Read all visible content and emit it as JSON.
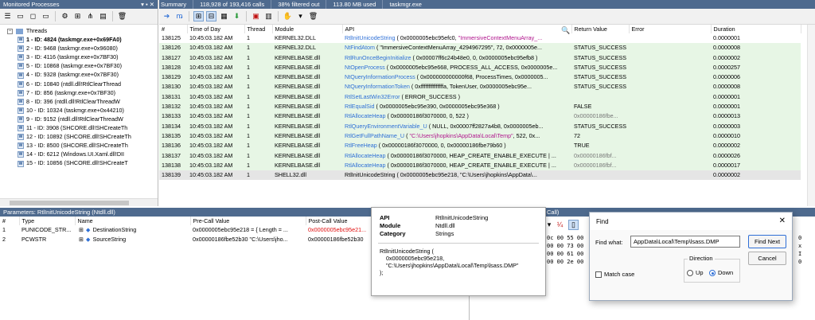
{
  "left_panel": {
    "title": "Monitored Processes",
    "title_controls": "▾ ▪ ✕",
    "root": "Threads",
    "threads": [
      {
        "label": "1 - ID: 4824 (taskmgr.exe+0x69FA0)",
        "selected": true
      },
      {
        "label": "2 - ID: 9468 (taskmgr.exe+0x96080)"
      },
      {
        "label": "3 - ID: 4116 (taskmgr.exe+0x7BF30)"
      },
      {
        "label": "5 - ID: 10868 (taskmgr.exe+0x7BF30)"
      },
      {
        "label": "4 - ID: 9328 (taskmgr.exe+0x7BF30)"
      },
      {
        "label": "6 - ID: 10840 (ntdll.dll!RtlClearThread"
      },
      {
        "label": "7 - ID: 856 (taskmgr.exe+0x7BF30)"
      },
      {
        "label": "8 - ID: 396 (ntdll.dll!RtlClearThreadW"
      },
      {
        "label": "10 - ID: 10324 (taskmgr.exe+0x44210)"
      },
      {
        "label": "9 - ID: 9152 (ntdll.dll!RtlClearThreadW"
      },
      {
        "label": "11 - ID: 3908 (SHCORE.dll!SHCreateTh"
      },
      {
        "label": "12 - ID: 10892 (SHCORE.dll!SHCreateTh"
      },
      {
        "label": "13 - ID: 8500 (SHCORE.dll!SHCreateTh"
      },
      {
        "label": "14 - ID: 6212 (Windows.UI.Xaml.dll!DII"
      },
      {
        "label": "15 - ID: 10856 (SHCORE.dll!SHCreateT"
      }
    ]
  },
  "summary_bar": {
    "label": "Summary",
    "calls": "118,928 of 193,416 calls",
    "filtered": "38% filtered out",
    "memory": "113.80 MB used",
    "process": "taskmgr.exe"
  },
  "grid": {
    "columns": [
      "#",
      "Time of Day",
      "Thread",
      "Module",
      "API",
      "Return Value",
      "Error",
      "Duration"
    ],
    "rows": [
      {
        "num": "138125",
        "time": "10:45:03.182 AM",
        "thread": "1",
        "module": "KERNEL32.DLL",
        "fn": "RtlInitUnicodeString",
        "args": " ( 0x0000005ebc95efc0, ",
        "str": "\"ImmersiveContextMenuArray_...",
        "ret": "",
        "ret_gray": false,
        "err": "",
        "dur": "0.0000001",
        "style": "white"
      },
      {
        "num": "138126",
        "time": "10:45:03.182 AM",
        "thread": "1",
        "module": "KERNEL32.DLL",
        "fn": "NtFindAtom",
        "args": " ( \"ImmersiveContextMenuArray_4294967295\", 72, 0x0000005e...",
        "str": "",
        "ret": "STATUS_SUCCESS",
        "ret_gray": false,
        "err": "",
        "dur": "0.0000008",
        "style": "green"
      },
      {
        "num": "138127",
        "time": "10:45:03.182 AM",
        "thread": "1",
        "module": "KERNELBASE.dll",
        "fn": "RtlRunOnceBeginInitialize",
        "args": " ( 0x00007ff6c24b48e0, 0, 0x0000005ebc95efb8 )",
        "str": "",
        "ret": "STATUS_SUCCESS",
        "ret_gray": false,
        "err": "",
        "dur": "0.0000002",
        "style": "green"
      },
      {
        "num": "138128",
        "time": "10:45:03.182 AM",
        "thread": "1",
        "module": "KERNELBASE.dll",
        "fn": "NtOpenProcess",
        "args": " ( 0x0000005ebc95e668, PROCESS_ALL_ACCESS, 0x0000005e...",
        "str": "",
        "ret": "STATUS_SUCCESS",
        "ret_gray": false,
        "err": "",
        "dur": "0.0000257",
        "style": "green"
      },
      {
        "num": "138129",
        "time": "10:45:03.182 AM",
        "thread": "1",
        "module": "KERNELBASE.dll",
        "fn": "NtQueryInformationProcess",
        "args": " ( 0x000000000000f68, ProcessTimes, 0x0000005...",
        "str": "",
        "ret": "STATUS_SUCCESS",
        "ret_gray": false,
        "err": "",
        "dur": "0.0000006",
        "style": "green"
      },
      {
        "num": "138130",
        "time": "10:45:03.182 AM",
        "thread": "1",
        "module": "KERNELBASE.dll",
        "fn": "NtQueryInformationToken",
        "args": " ( 0xfffffffffffffffa, TokenUser, 0x0000005ebc95e...",
        "str": "",
        "ret": "STATUS_SUCCESS",
        "ret_gray": false,
        "err": "",
        "dur": "0.0000008",
        "style": "green"
      },
      {
        "num": "138131",
        "time": "10:45:03.182 AM",
        "thread": "1",
        "module": "KERNELBASE.dll",
        "fn": "RtlSetLastWin32Error",
        "args": " ( ERROR_SUCCESS )",
        "str": "",
        "ret": "",
        "ret_gray": false,
        "err": "",
        "dur": "0.0000001",
        "style": "green"
      },
      {
        "num": "138132",
        "time": "10:45:03.182 AM",
        "thread": "1",
        "module": "KERNELBASE.dll",
        "fn": "RtlEqualSid",
        "args": " ( 0x0000005ebc95e390, 0x0000005ebc95e368 )",
        "str": "",
        "ret": "FALSE",
        "ret_gray": false,
        "err": "",
        "dur": "0.0000001",
        "style": "green"
      },
      {
        "num": "138133",
        "time": "10:45:03.182 AM",
        "thread": "1",
        "module": "KERNELBASE.dll",
        "fn": "RtlAllocateHeap",
        "args": " ( 0x00000186f3070000, 0, 522 )",
        "str": "",
        "ret": "0x00000186fbe...",
        "ret_gray": true,
        "err": "",
        "dur": "0.0000013",
        "style": "green"
      },
      {
        "num": "138134",
        "time": "10:45:03.182 AM",
        "thread": "1",
        "module": "KERNELBASE.dll",
        "fn": "RtlQueryEnvironmentVariable_U",
        "args": " ( NULL, 0x00007ff2827a4b8, 0x0000005eb...",
        "str": "",
        "ret": "STATUS_SUCCESS",
        "ret_gray": false,
        "err": "",
        "dur": "0.0000003",
        "style": "green"
      },
      {
        "num": "138135",
        "time": "10:45:03.182 AM",
        "thread": "1",
        "module": "KERNELBASE.dll",
        "fn": "RtlGetFullPathName_U",
        "args": " ( ",
        "str": "\"C:\\Users\\jhopkins\\AppData\\Local\\Temp\"",
        "args2": ", 522, 0x...",
        "ret": "72",
        "ret_gray": false,
        "err": "",
        "dur": "0.0000010",
        "style": "green"
      },
      {
        "num": "138136",
        "time": "10:45:03.182 AM",
        "thread": "1",
        "module": "KERNELBASE.dll",
        "fn": "RtlFreeHeap",
        "args": " ( 0x00000186f3070000, 0, 0x00000186fbe79b60 )",
        "str": "",
        "ret": "TRUE",
        "ret_gray": false,
        "err": "",
        "dur": "0.0000002",
        "style": "green"
      },
      {
        "num": "138137",
        "time": "10:45:03.182 AM",
        "thread": "1",
        "module": "KERNELBASE.dll",
        "fn": "RtlAllocateHeap",
        "args": " ( 0x00000186f3070000, HEAP_CREATE_ENABLE_EXECUTE | ...",
        "str": "",
        "ret": "0x00000186fbf...",
        "ret_gray": true,
        "err": "",
        "dur": "0.0000026",
        "style": "green"
      },
      {
        "num": "138138",
        "time": "10:45:03.182 AM",
        "thread": "1",
        "module": "KERNELBASE.dll",
        "fn": "RtlAllocateHeap",
        "args": " ( 0x00000186f3070000, HEAP_CREATE_ENABLE_EXECUTE | ...",
        "str": "",
        "ret": "0x00000186fbf...",
        "ret_gray": true,
        "err": "",
        "dur": "0.0000017",
        "style": "green"
      },
      {
        "num": "138139",
        "time": "10:45:03.182 AM",
        "thread": "1",
        "module": "SHELL32.dll",
        "fn": "RtlInitUnicodeString",
        "args": " ( 0x0000005ebc95e218, \"C:\\Users\\jhopkins\\AppData\\...",
        "str": "",
        "ret": "",
        "ret_gray": false,
        "err": "",
        "dur": "0.0000002",
        "style": "sel",
        "fn_plain": true
      }
    ]
  },
  "params_panel": {
    "title": "Parameters: RtlInitUnicodeString (Ntdll.dll)",
    "columns": [
      "#",
      "Type",
      "Name",
      "Pre-Call Value",
      "Post-Call Value"
    ],
    "rows": [
      {
        "num": "1",
        "type": "PUNICODE_STR...",
        "name": "DestinationString",
        "pre": "0x0000005ebc95e218 = { Length = ...",
        "post": "0x0000005ebc95e21..."
      },
      {
        "num": "2",
        "type": "PCWSTR",
        "name": "SourceString",
        "pre": "0x00000186fbe52b30 \"C:\\Users\\jho...",
        "post": "0x00000186fbe52b30"
      }
    ]
  },
  "hex_panel": {
    "title_fragment": "Call)",
    "lines": [
      "0c 00 55 00",
      "00 00 73 00",
      "00 00 61 00",
      "00 00 2e 00"
    ],
    "right_col": [
      "0",
      "x",
      "I",
      "0"
    ]
  },
  "tooltip": {
    "fields": [
      {
        "k": "API",
        "v": "RtlInitUnicodeString"
      },
      {
        "k": "Module",
        "v": "Ntdll.dll"
      },
      {
        "k": "Category",
        "v": "Strings"
      }
    ],
    "call_line1": "RtlInitUnicodeString (",
    "call_line2": "0x0000005ebc95e218,",
    "call_line3": "\"C:\\Users\\jhopkins\\AppData\\Local\\Temp\\lsass.DMP\"",
    "call_line4": ");"
  },
  "find_dialog": {
    "title": "Find",
    "find_what_label": "Find what:",
    "find_what_value": "AppData\\Local\\Temp\\lsass.DMP",
    "find_next": "Find Next",
    "cancel": "Cancel",
    "direction_label": "Direction",
    "up_label": "Up",
    "down_label": "Down",
    "match_case_label": "Match case",
    "close_glyph": "✕"
  },
  "colors": {
    "title_blue": "#4e6a8e",
    "row_green": "#e7f6e5",
    "api_blue": "#2d6fd6",
    "string_magenta": "#b0148c",
    "changed_red": "#e01010"
  }
}
